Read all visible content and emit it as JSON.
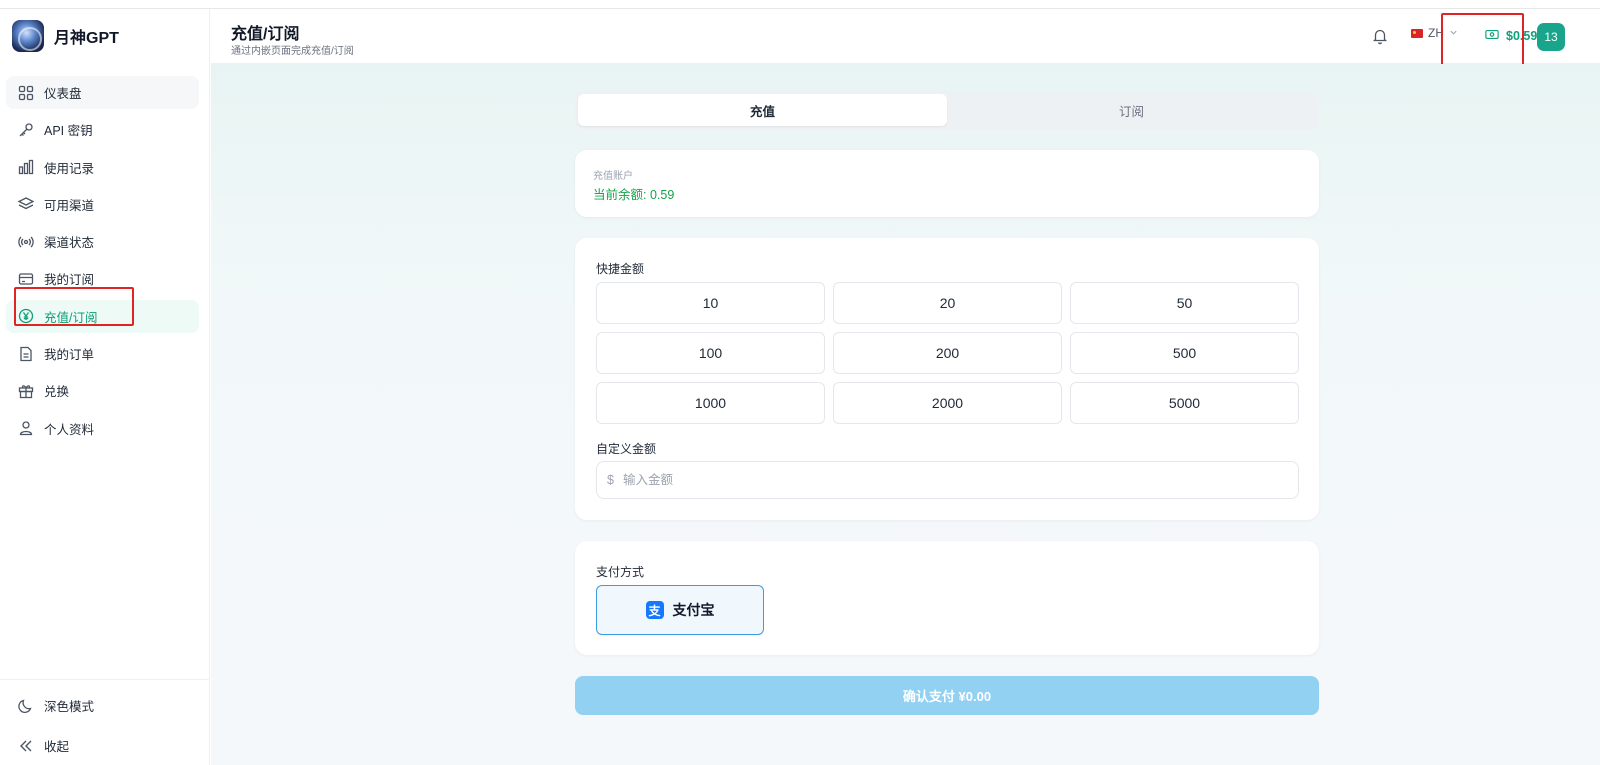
{
  "brand": {
    "name": "月神GPT"
  },
  "sidebar": {
    "items": [
      {
        "label": "仪表盘",
        "icon": "dashboard-icon"
      },
      {
        "label": "API 密钥",
        "icon": "key-icon"
      },
      {
        "label": "使用记录",
        "icon": "bar-chart-icon"
      },
      {
        "label": "可用渠道",
        "icon": "layers-icon"
      },
      {
        "label": "渠道状态",
        "icon": "broadcast-icon"
      },
      {
        "label": "我的订阅",
        "icon": "credit-card-icon"
      },
      {
        "label": "充值/订阅",
        "icon": "yen-coin-icon"
      },
      {
        "label": "我的订单",
        "icon": "document-icon"
      },
      {
        "label": "兑换",
        "icon": "gift-icon"
      },
      {
        "label": "个人资料",
        "icon": "user-icon"
      }
    ],
    "active_index": 6,
    "bottom": [
      {
        "label": "深色模式",
        "icon": "moon-icon"
      },
      {
        "label": "收起",
        "icon": "collapse-icon"
      }
    ]
  },
  "header": {
    "title": "充值/订阅",
    "subtitle": "通过内嵌页面完成充值/订阅",
    "language": "ZH",
    "balance": "$0.59",
    "avatar_text": "13"
  },
  "tabs": [
    {
      "label": "充值",
      "active": true
    },
    {
      "label": "订阅",
      "active": false
    }
  ],
  "account": {
    "label": "充值账户",
    "balance_text": "当前余额: 0.59"
  },
  "quick_amount": {
    "label": "快捷金额",
    "options": [
      "10",
      "20",
      "50",
      "100",
      "200",
      "500",
      "1000",
      "2000",
      "5000"
    ]
  },
  "custom_amount": {
    "label": "自定义金额",
    "currency_symbol": "$",
    "placeholder": "输入金额",
    "value": ""
  },
  "payment": {
    "label": "支付方式",
    "method": "支付宝",
    "method_icon_text": "支"
  },
  "confirm": {
    "label": "确认支付 ¥0.00"
  },
  "colors": {
    "accent": "#0f9f7a",
    "highlight_box": "#e02424",
    "confirm_disabled": "#93d1f3",
    "alipay_blue": "#1677ff"
  }
}
